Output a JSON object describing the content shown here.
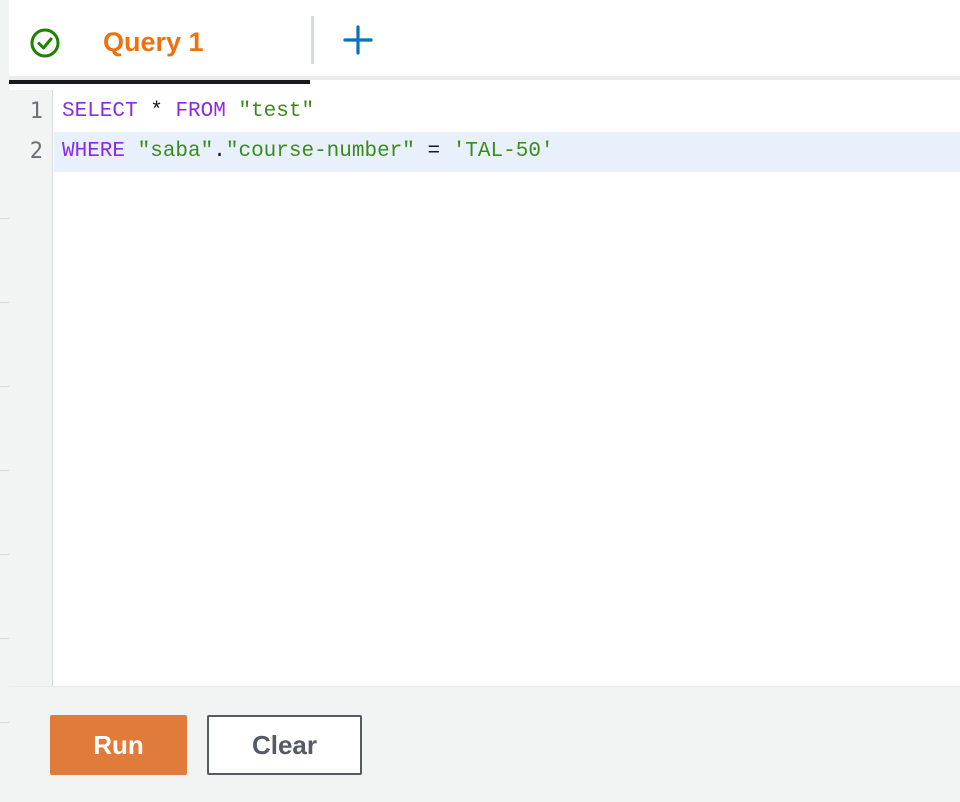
{
  "tabs": [
    {
      "label": "Query 1",
      "status_icon": "check-circle-icon",
      "active": true
    }
  ],
  "add_tab_icon": "plus-icon",
  "editor": {
    "lines": [
      {
        "number": "1",
        "tokens": [
          {
            "text": "SELECT",
            "type": "kw"
          },
          {
            "text": " * ",
            "type": "op"
          },
          {
            "text": "FROM",
            "type": "kw"
          },
          {
            "text": " ",
            "type": "op"
          },
          {
            "text": "\"test\"",
            "type": "str"
          }
        ]
      },
      {
        "number": "2",
        "tokens": [
          {
            "text": "WHERE",
            "type": "kw"
          },
          {
            "text": " ",
            "type": "op"
          },
          {
            "text": "\"saba\"",
            "type": "str"
          },
          {
            "text": ".",
            "type": "op"
          },
          {
            "text": "\"course-number\"",
            "type": "str"
          },
          {
            "text": " = ",
            "type": "op"
          },
          {
            "text": "'TAL-50'",
            "type": "str"
          }
        ]
      }
    ],
    "active_line": "2"
  },
  "buttons": {
    "run_label": "Run",
    "clear_label": "Clear"
  },
  "colors": {
    "accent": "#ec7211",
    "run_button": "#e07b39",
    "keyword": "#8a2be2",
    "string": "#3c8a1c",
    "success": "#1d8102",
    "add_icon": "#0073bb"
  }
}
